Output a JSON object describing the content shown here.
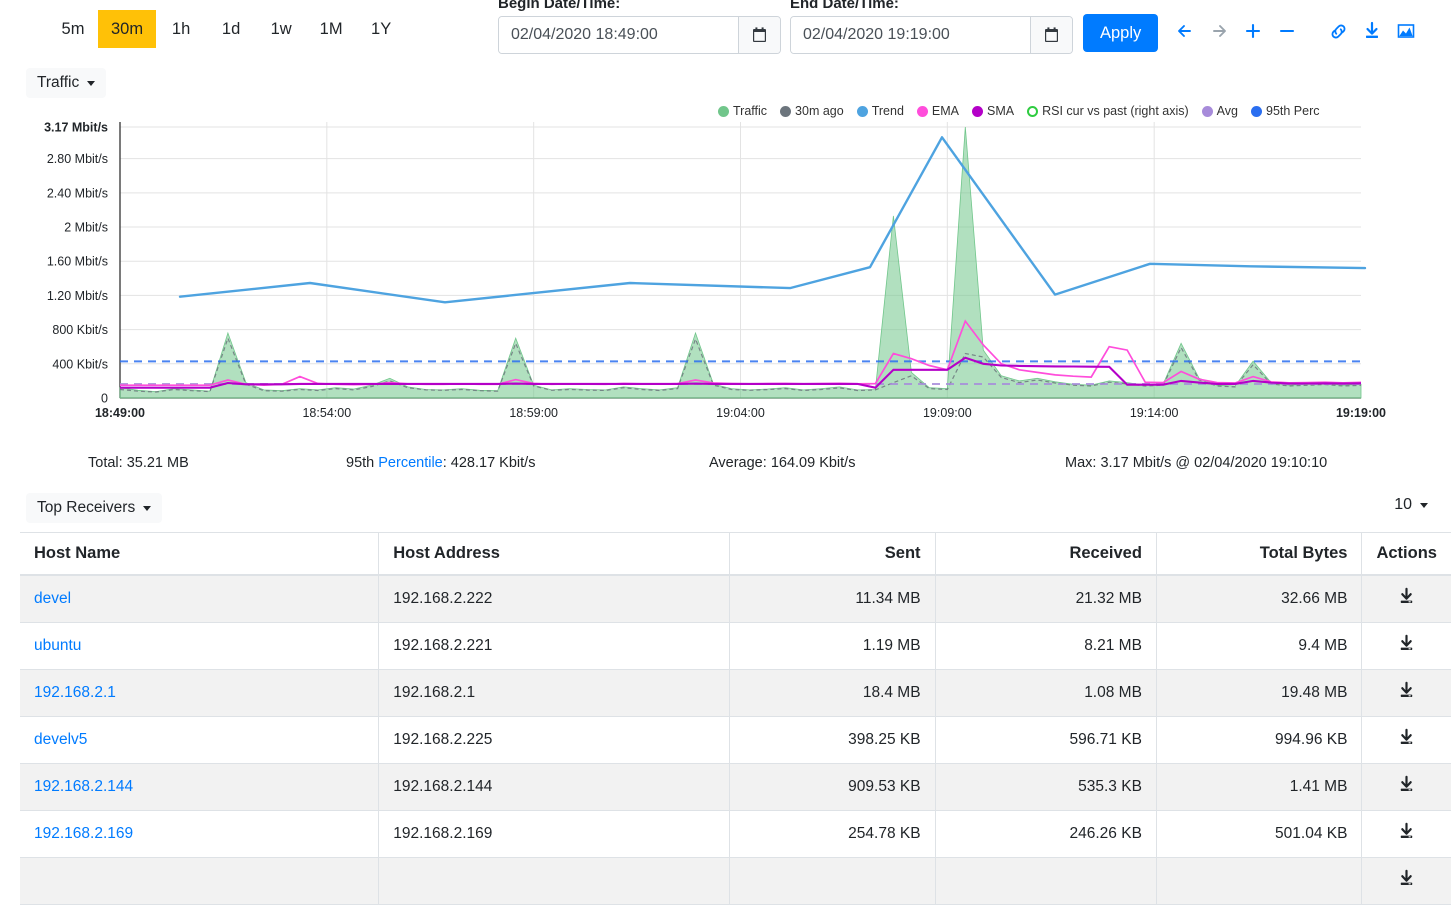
{
  "toolbar": {
    "ranges": [
      {
        "label": "5m",
        "active": false
      },
      {
        "label": "30m",
        "active": true
      },
      {
        "label": "1h",
        "active": false
      },
      {
        "label": "1d",
        "active": false
      },
      {
        "label": "1w",
        "active": false
      },
      {
        "label": "1M",
        "active": false
      },
      {
        "label": "1Y",
        "active": false
      }
    ],
    "begin_label": "Begin Date/Time:",
    "begin_value": "02/04/2020 18:49:00",
    "end_label": "End Date/Time:",
    "end_value": "02/04/2020 19:19:00",
    "apply_label": "Apply",
    "icons": [
      {
        "name": "arrow-left-icon",
        "glyph": "←",
        "disabled": false
      },
      {
        "name": "arrow-right-icon",
        "glyph": "→",
        "disabled": true
      },
      {
        "name": "zoom-in-icon",
        "glyph": "+",
        "disabled": false
      },
      {
        "name": "zoom-out-icon",
        "glyph": "−",
        "disabled": false
      },
      {
        "name": "link-icon",
        "glyph": "🔗",
        "disabled": false
      },
      {
        "name": "download-icon",
        "glyph": "⬇",
        "disabled": false
      },
      {
        "name": "chart-icon",
        "glyph": "📈",
        "disabled": false
      }
    ],
    "colors": {
      "active_range": "#ffc107",
      "apply_bg": "#007bff",
      "icon_active": "#007bff",
      "icon_disabled": "#9aa4ad"
    }
  },
  "metric_select": {
    "label": "Traffic"
  },
  "chart_data": {
    "type": "area",
    "title": "",
    "xlabel": "",
    "ylabel": "",
    "grid": true,
    "legend_position": "top-right",
    "x_ticks": [
      "18:49:00",
      "18:54:00",
      "18:59:00",
      "19:04:00",
      "19:09:00",
      "19:14:00",
      "19:19:00"
    ],
    "x_tick_bold": [
      true,
      false,
      false,
      false,
      false,
      false,
      true
    ],
    "y_ticks": [
      "0",
      "400 Kbit/s",
      "800 Kbit/s",
      "1.20 Mbit/s",
      "1.60 Mbit/s",
      "2 Mbit/s",
      "2.40 Mbit/s",
      "2.80 Mbit/s",
      "3.17 Mbit/s"
    ],
    "y_tick_values": [
      0,
      400,
      800,
      1200,
      1600,
      2000,
      2400,
      2800,
      3170
    ],
    "y_unit": "Kbit/s",
    "ylim": [
      0,
      3170
    ],
    "y_max_label": "3.17 Mbit/s",
    "legend": [
      {
        "label": "Traffic",
        "color": "#71c68b",
        "style": "filled"
      },
      {
        "label": "30m ago",
        "color": "#6c757d",
        "style": "filled"
      },
      {
        "label": "Trend",
        "color": "#4ea3e0",
        "style": "filled"
      },
      {
        "label": "EMA",
        "color": "#ff4ddb",
        "style": "filled"
      },
      {
        "label": "SMA",
        "color": "#b400c8",
        "style": "filled"
      },
      {
        "label": "RSI cur vs past (right axis)",
        "color": "#2ecc40",
        "style": "hollow"
      },
      {
        "label": "Avg",
        "color": "#a78bda",
        "style": "filled"
      },
      {
        "label": "95th Perc",
        "color": "#2a6ef0",
        "style": "filled"
      }
    ],
    "reference_lines": [
      {
        "name": "95th Perc",
        "value": 428.17,
        "color": "#2a6ef0",
        "dash": true
      },
      {
        "name": "Avg",
        "value": 164.09,
        "color": "#a78bda",
        "dash": true
      }
    ],
    "series": [
      {
        "name": "Traffic",
        "color": "#71c68b",
        "type": "area",
        "values": [
          120,
          90,
          75,
          110,
          95,
          80,
          760,
          180,
          95,
          85,
          110,
          95,
          120,
          105,
          150,
          230,
          130,
          100,
          95,
          110,
          90,
          85,
          700,
          150,
          95,
          110,
          100,
          95,
          130,
          110,
          95,
          120,
          760,
          160,
          110,
          95,
          105,
          120,
          95,
          110,
          130,
          95,
          100,
          2130,
          300,
          120,
          110,
          3170,
          560,
          260,
          200,
          230,
          190,
          160,
          150,
          200,
          180,
          150,
          165,
          640,
          230,
          150,
          140,
          430,
          180,
          150,
          160,
          170,
          150,
          160
        ]
      },
      {
        "name": "30m ago",
        "color": "#6c757d",
        "type": "dashed-line",
        "values": [
          100,
          80,
          70,
          100,
          85,
          75,
          700,
          160,
          85,
          80,
          100,
          88,
          110,
          95,
          135,
          200,
          120,
          95,
          90,
          100,
          85,
          80,
          640,
          140,
          90,
          100,
          92,
          88,
          120,
          100,
          88,
          110,
          690,
          150,
          100,
          90,
          98,
          110,
          88,
          100,
          118,
          88,
          95,
          180,
          260,
          110,
          100,
          520,
          480,
          240,
          180,
          210,
          175,
          150,
          140,
          185,
          165,
          140,
          150,
          590,
          210,
          140,
          130,
          390,
          165,
          140,
          148,
          158,
          140,
          148
        ]
      },
      {
        "name": "Trend",
        "color": "#4ea3e0",
        "type": "line",
        "x_points": [
          180,
          310,
          445,
          630,
          790,
          870,
          942,
          1055,
          1150,
          1250,
          1365
        ],
        "values": [
          1185,
          1345,
          1120,
          1345,
          1285,
          1530,
          3050,
          1210,
          1570,
          1540,
          1520
        ]
      },
      {
        "name": "EMA",
        "color": "#ff4ddb",
        "type": "line",
        "values": [
          150,
          150,
          150,
          150,
          150,
          150,
          210,
          160,
          150,
          160,
          250,
          170,
          160,
          155,
          160,
          180,
          165,
          160,
          160,
          165,
          160,
          160,
          215,
          170,
          160,
          165,
          162,
          160,
          170,
          165,
          162,
          168,
          210,
          175,
          168,
          165,
          168,
          170,
          165,
          168,
          172,
          165,
          168,
          520,
          460,
          380,
          330,
          900,
          620,
          400,
          330,
          300,
          270,
          255,
          245,
          600,
          560,
          185,
          180,
          310,
          220,
          180,
          175,
          250,
          190,
          178,
          180,
          185,
          178,
          182
        ]
      },
      {
        "name": "SMA",
        "color": "#b400c8",
        "type": "line",
        "values": [
          120,
          120,
          120,
          120,
          120,
          120,
          175,
          160,
          160,
          160,
          165,
          165,
          165,
          165,
          165,
          165,
          165,
          165,
          165,
          165,
          165,
          165,
          168,
          165,
          165,
          165,
          165,
          165,
          165,
          165,
          165,
          165,
          168,
          165,
          165,
          165,
          165,
          165,
          165,
          165,
          165,
          165,
          120,
          330,
          330,
          330,
          330,
          470,
          400,
          380,
          375,
          372,
          370,
          368,
          366,
          365,
          155,
          155,
          155,
          200,
          180,
          165,
          165,
          200,
          180,
          168,
          170,
          172,
          168,
          172
        ]
      }
    ]
  },
  "stats": {
    "total_label": "Total:",
    "total_value": "35.21 MB",
    "perc_prefix": "95th ",
    "perc_link": "Percentile",
    "perc_sep": ": ",
    "perc_value": "428.17 Kbit/s",
    "avg_label": "Average:",
    "avg_value": "164.09 Kbit/s",
    "max_label": "Max:",
    "max_value": "3.17 Mbit/s @ 02/04/2020 19:10:10"
  },
  "table_section": {
    "selector_label": "Top Receivers",
    "page_size": "10",
    "columns": [
      "Host Name",
      "Host Address",
      "Sent",
      "Received",
      "Total Bytes",
      "Actions"
    ],
    "rows": [
      {
        "host": "devel",
        "address": "192.168.2.222",
        "sent": "11.34 MB",
        "received": "21.32 MB",
        "total": "32.66 MB",
        "action": "download-icon"
      },
      {
        "host": "ubuntu",
        "address": "192.168.2.221",
        "sent": "1.19 MB",
        "received": "8.21 MB",
        "total": "9.4 MB",
        "action": "download-icon"
      },
      {
        "host": "192.168.2.1",
        "address": "192.168.2.1",
        "sent": "18.4 MB",
        "received": "1.08 MB",
        "total": "19.48 MB",
        "action": "download-icon"
      },
      {
        "host": "develv5",
        "address": "192.168.2.225",
        "sent": "398.25 KB",
        "received": "596.71 KB",
        "total": "994.96 KB",
        "action": "download-icon"
      },
      {
        "host": "192.168.2.144",
        "address": "192.168.2.144",
        "sent": "909.53 KB",
        "received": "535.3 KB",
        "total": "1.41 MB",
        "action": "download-icon"
      },
      {
        "host": "192.168.2.169",
        "address": "192.168.2.169",
        "sent": "254.78 KB",
        "received": "246.26 KB",
        "total": "501.04 KB",
        "action": "download-icon"
      },
      {
        "host": "",
        "address": "",
        "sent": "",
        "received": "",
        "total": "",
        "action": "download-icon"
      }
    ]
  }
}
